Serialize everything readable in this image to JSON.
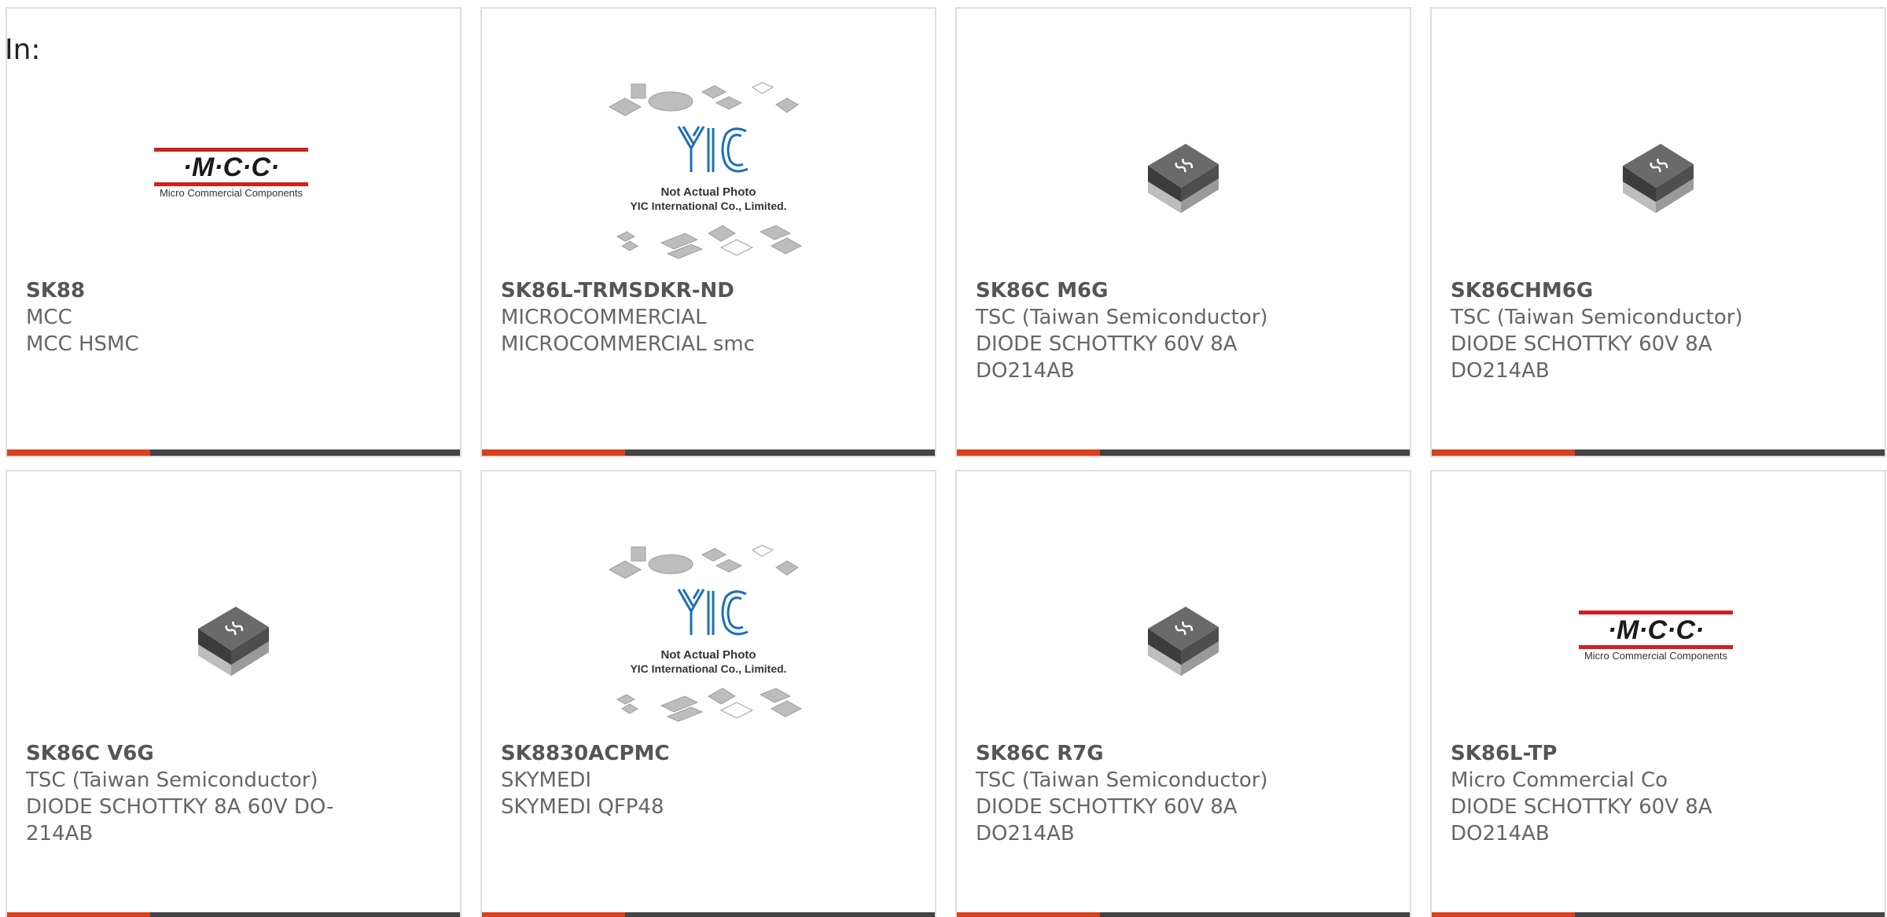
{
  "header": {
    "in_label": "In:"
  },
  "colors": {
    "accent": "#d9401b",
    "bar_dark": "#444444",
    "mcc_red": "#d0211f"
  },
  "images": {
    "mcc_logo": {
      "brand": "·M·C·C·",
      "tagline": "Micro Commercial Components"
    },
    "yic_placeholder": {
      "brand": "YIC",
      "line1": "Not Actual Photo",
      "line2": "YIC International Co., Limited."
    },
    "tsc_chip": {
      "icon": "smd-diode-chip-icon"
    }
  },
  "cards": [
    {
      "part": "SK88",
      "manufacturer": "MCC",
      "description": "MCC HSMC",
      "extra": "",
      "image": "mcc_logo"
    },
    {
      "part": "SK86L-TRMSDKR-ND",
      "manufacturer": "MICROCOMMERCIAL",
      "description": "MICROCOMMERCIAL smc",
      "extra": "",
      "image": "yic_placeholder"
    },
    {
      "part": "SK86C M6G",
      "manufacturer": "TSC (Taiwan Semiconductor)",
      "description": "DIODE SCHOTTKY 60V 8A",
      "extra": "DO214AB",
      "image": "tsc_chip"
    },
    {
      "part": "SK86CHM6G",
      "manufacturer": "TSC (Taiwan Semiconductor)",
      "description": "DIODE SCHOTTKY 60V 8A",
      "extra": "DO214AB",
      "image": "tsc_chip"
    },
    {
      "part": "SK86C V6G",
      "manufacturer": "TSC (Taiwan Semiconductor)",
      "description": "DIODE SCHOTTKY 8A 60V DO-",
      "extra": "214AB",
      "image": "tsc_chip"
    },
    {
      "part": "SK8830ACPMC",
      "manufacturer": "SKYMEDI",
      "description": "SKYMEDI QFP48",
      "extra": "",
      "image": "yic_placeholder"
    },
    {
      "part": "SK86C R7G",
      "manufacturer": "TSC (Taiwan Semiconductor)",
      "description": "DIODE SCHOTTKY 60V 8A",
      "extra": "DO214AB",
      "image": "tsc_chip"
    },
    {
      "part": "SK86L-TP",
      "manufacturer": "Micro Commercial Co",
      "description": "DIODE SCHOTTKY 60V 8A",
      "extra": "DO214AB",
      "image": "mcc_logo"
    }
  ]
}
